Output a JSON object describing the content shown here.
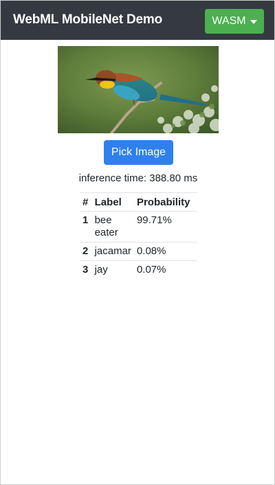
{
  "navbar": {
    "title": "WebML MobileNet Demo",
    "backend_label": "WASM"
  },
  "image": {
    "icon": "bee-eater-photo"
  },
  "pick_button_label": "Pick Image",
  "inference_time": "inference time: 388.80 ms",
  "results": {
    "headers": [
      "#",
      "Label",
      "Probability"
    ],
    "rows": [
      {
        "rank": "1",
        "label": "bee eater",
        "probability": "99.71%"
      },
      {
        "rank": "2",
        "label": "jacamar",
        "probability": "0.08%"
      },
      {
        "rank": "3",
        "label": "jay",
        "probability": "0.07%"
      }
    ]
  },
  "colors": {
    "navbar": "#343a40",
    "backend_button": "#4caf50",
    "pick_button": "#2f80ed"
  }
}
